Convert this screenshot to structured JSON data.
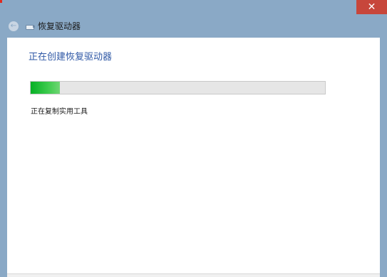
{
  "window": {
    "close_glyph": "✕",
    "accent_color": "#8aa9c6",
    "close_color": "#c7463b"
  },
  "header": {
    "back_glyph": "←",
    "title": "恢复驱动器",
    "icon": "usb-drive-icon"
  },
  "main": {
    "heading": "正在创建恢复驱动器",
    "progress_percent": 10,
    "progress_color": "#06b025",
    "status": "正在复制实用工具"
  }
}
